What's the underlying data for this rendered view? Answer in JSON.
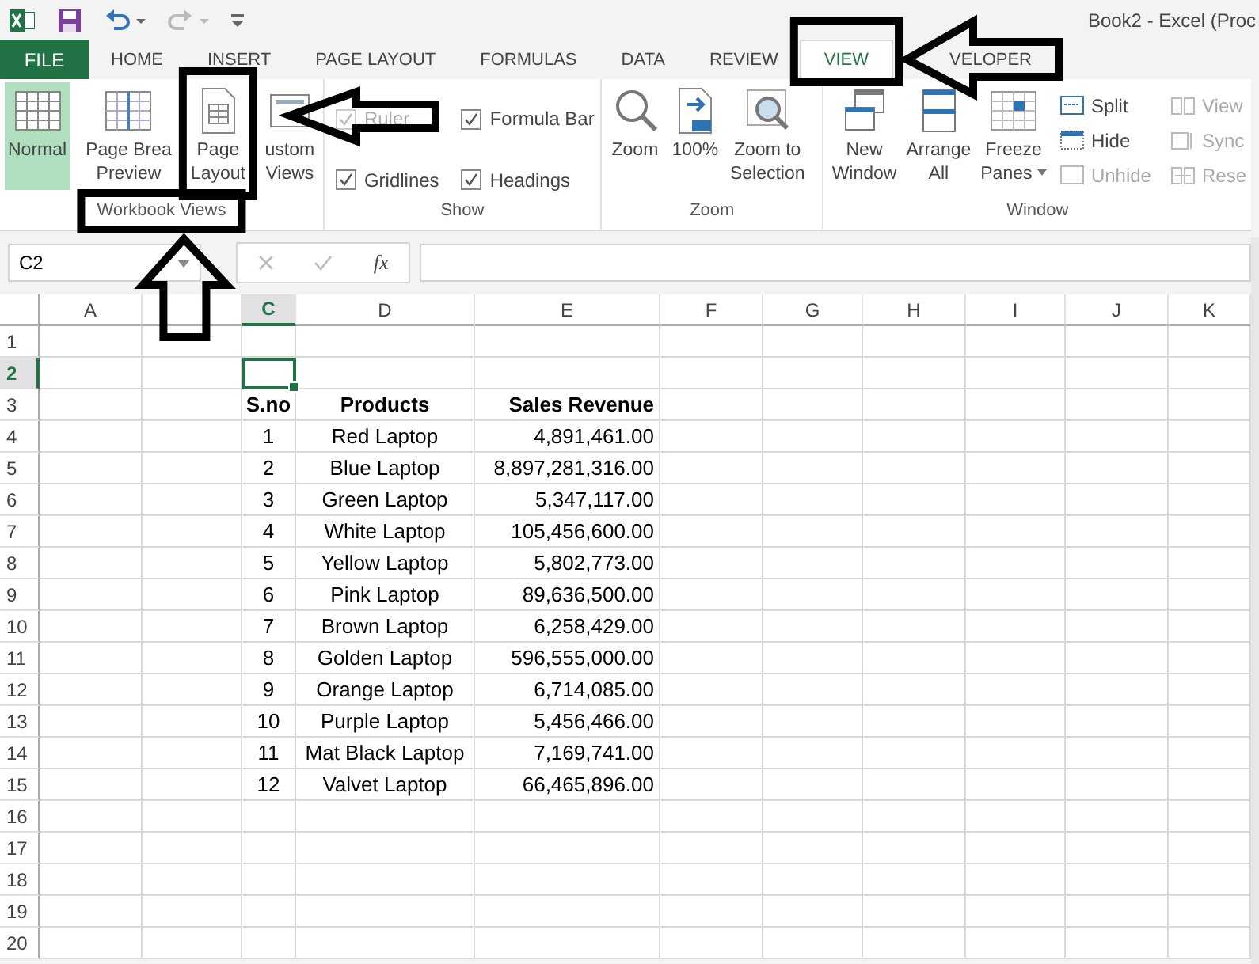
{
  "window": {
    "title": "Book2 - Excel (Proc"
  },
  "tabs": [
    {
      "label": "FILE",
      "kind": "file",
      "selected": false
    },
    {
      "label": "HOME",
      "kind": "tab",
      "selected": false
    },
    {
      "label": "INSERT",
      "kind": "tab",
      "selected": false
    },
    {
      "label": "PAGE LAYOUT",
      "kind": "tab",
      "selected": false
    },
    {
      "label": "FORMULAS",
      "kind": "tab",
      "selected": false
    },
    {
      "label": "DATA",
      "kind": "tab",
      "selected": false
    },
    {
      "label": "REVIEW",
      "kind": "tab",
      "selected": false
    },
    {
      "label": "VIEW",
      "kind": "tab",
      "selected": true
    },
    {
      "label": "VELOPER",
      "kind": "tab",
      "selected": false
    }
  ],
  "ribbon": {
    "groups": [
      {
        "label": "Workbook Views",
        "items": [
          {
            "kind": "large",
            "lines": [
              "Normal"
            ],
            "selected": true
          },
          {
            "kind": "large",
            "lines": [
              "Page Brea",
              "Preview"
            ],
            "selected": false
          },
          {
            "kind": "large",
            "lines": [
              "Page",
              "Layout"
            ],
            "selected": false
          },
          {
            "kind": "large",
            "lines": [
              "ustom",
              "Views"
            ],
            "selected": false
          }
        ]
      },
      {
        "label": "Show",
        "items": [
          {
            "kind": "checkbox",
            "label": "Ruler",
            "checked": true,
            "disabled": true
          },
          {
            "kind": "checkbox",
            "label": "Formula Bar",
            "checked": true,
            "disabled": false
          },
          {
            "kind": "checkbox",
            "label": "Gridlines",
            "checked": true,
            "disabled": false
          },
          {
            "kind": "checkbox",
            "label": "Headings",
            "checked": true,
            "disabled": false
          }
        ]
      },
      {
        "label": "Zoom",
        "items": [
          {
            "kind": "large",
            "lines": [
              "Zoom"
            ],
            "selected": false
          },
          {
            "kind": "large",
            "lines": [
              "100%"
            ],
            "selected": false
          },
          {
            "kind": "large",
            "lines": [
              "Zoom to",
              "Selection"
            ],
            "selected": false
          }
        ]
      },
      {
        "label": "Window",
        "items": [
          {
            "kind": "large",
            "lines": [
              "New",
              "Window"
            ],
            "selected": false
          },
          {
            "kind": "large",
            "lines": [
              "Arrange",
              "All"
            ],
            "selected": false
          },
          {
            "kind": "large",
            "lines": [
              "Freeze",
              "Panes"
            ],
            "dropdown": true,
            "selected": false
          },
          {
            "kind": "small",
            "label": "Split",
            "disabled": false
          },
          {
            "kind": "small",
            "label": "Hide",
            "disabled": false
          },
          {
            "kind": "small",
            "label": "Unhide",
            "disabled": true
          },
          {
            "kind": "small",
            "label": "View",
            "disabled": true
          },
          {
            "kind": "small",
            "label": "Sync",
            "disabled": true
          },
          {
            "kind": "small",
            "label": "Rese",
            "disabled": true
          }
        ]
      }
    ]
  },
  "name_box": {
    "value": "C2"
  },
  "formula_bar": {
    "fx": "fx"
  },
  "sheet": {
    "columns": [
      {
        "label": "A",
        "selected": false
      },
      {
        "selected": false
      },
      {
        "label": "C",
        "selected": true
      },
      {
        "label": "D",
        "selected": false
      },
      {
        "label": "E",
        "selected": false
      },
      {
        "label": "F",
        "selected": false
      },
      {
        "label": "G",
        "selected": false
      },
      {
        "label": "H",
        "selected": false
      },
      {
        "label": "I",
        "selected": false
      },
      {
        "label": "J",
        "selected": false
      },
      {
        "label": "K",
        "selected": false
      }
    ],
    "rows": [
      {
        "number": "1",
        "selected": false
      },
      {
        "number": "2",
        "selected": true
      },
      {
        "number": "3",
        "selected": false,
        "kind": "header",
        "values": [
          "S.no",
          "Products",
          "Sales Revenue"
        ]
      },
      {
        "number": "4",
        "selected": false,
        "values": [
          "1",
          "Red Laptop",
          "4,891,461.00"
        ]
      },
      {
        "number": "5",
        "selected": false,
        "values": [
          "2",
          "Blue Laptop",
          "8,897,281,316.00"
        ]
      },
      {
        "number": "6",
        "selected": false,
        "values": [
          "3",
          "Green Laptop",
          "5,347,117.00"
        ]
      },
      {
        "number": "7",
        "selected": false,
        "values": [
          "4",
          "White Laptop",
          "105,456,600.00"
        ]
      },
      {
        "number": "8",
        "selected": false,
        "values": [
          "5",
          "Yellow Laptop",
          "5,802,773.00"
        ]
      },
      {
        "number": "9",
        "selected": false,
        "values": [
          "6",
          "Pink Laptop",
          "89,636,500.00"
        ]
      },
      {
        "number": "10",
        "selected": false,
        "values": [
          "7",
          "Brown Laptop",
          "6,258,429.00"
        ]
      },
      {
        "number": "11",
        "selected": false,
        "values": [
          "8",
          "Golden Laptop",
          "596,555,000.00"
        ]
      },
      {
        "number": "12",
        "selected": false,
        "values": [
          "9",
          "Orange Laptop",
          "6,714,085.00"
        ]
      },
      {
        "number": "13",
        "selected": false,
        "values": [
          "10",
          "Purple Laptop",
          "5,456,466.00"
        ]
      },
      {
        "number": "14",
        "selected": false,
        "values": [
          "11",
          "Mat Black Laptop",
          "7,169,741.00"
        ]
      },
      {
        "number": "15",
        "selected": false,
        "values": [
          "12",
          "Valvet Laptop",
          "66,465,896.00"
        ]
      },
      {
        "number": "16",
        "selected": false
      },
      {
        "number": "17",
        "selected": false
      },
      {
        "number": "18",
        "selected": false
      },
      {
        "number": "19",
        "selected": false
      },
      {
        "number": "20",
        "selected": false
      }
    ]
  }
}
